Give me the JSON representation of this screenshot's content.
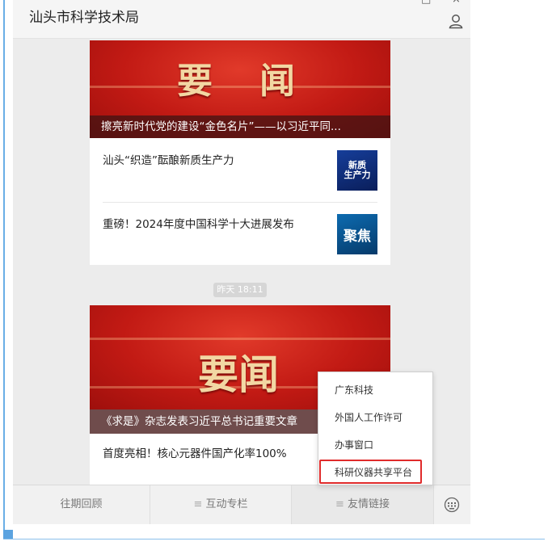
{
  "window": {
    "title": "汕头市科学技术局",
    "controls": {
      "minimize": "−",
      "restore": "◦",
      "maximize": "□",
      "close": "×"
    }
  },
  "feed": {
    "article_group_1": {
      "banner_text": "要  闻",
      "headline": "擦亮新时代党的建设“金色名片”——以习近平同...",
      "items": [
        {
          "title": "汕头“织造”酝酿新质生产力",
          "thumb_text": "新质\n生产力"
        },
        {
          "title": "重磅！2024年度中国科学十大进展发布",
          "thumb_text": "聚焦"
        }
      ]
    },
    "timestamp": "昨天 18:11",
    "article_group_2": {
      "banner_text": "要闻",
      "headline": "《求是》杂志发表习近平总书记重要文章",
      "items": [
        {
          "title": "首度亮相！核心元器件国产化率100%"
        }
      ]
    }
  },
  "bottom_menu": {
    "tabs": [
      {
        "label": "往期回顾",
        "has_menu_icon": false
      },
      {
        "label": "互动专栏",
        "has_menu_icon": true
      },
      {
        "label": "友情链接",
        "has_menu_icon": true
      }
    ],
    "menu_mark": "≡",
    "keyboard_icon": "keyboard-icon"
  },
  "popup_menu": {
    "items": [
      "广东科技",
      "外国人工作许可",
      "办事窗口",
      "科研仪器共享平台"
    ],
    "highlighted_item": "科研仪器共享平台",
    "highlight_color": "#e02b2b"
  },
  "colors": {
    "banner_red": "#c21a14",
    "banner_text_gold": "#f2d7a3",
    "frame_blue": "#6aaee6"
  }
}
